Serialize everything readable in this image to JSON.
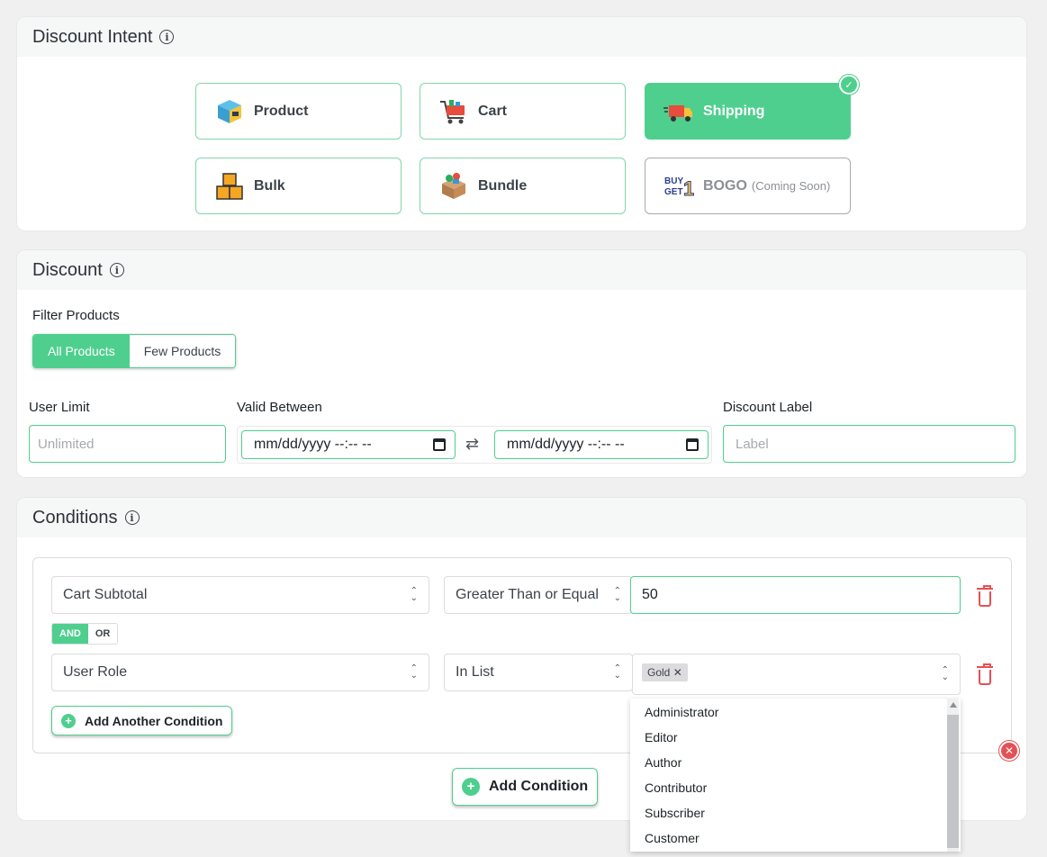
{
  "intent": {
    "title": "Discount Intent",
    "cards": [
      {
        "label": "Product",
        "icon": "product-box-icon"
      },
      {
        "label": "Cart",
        "icon": "cart-icon"
      },
      {
        "label": "Shipping",
        "icon": "shipping-truck-icon",
        "selected": true
      },
      {
        "label": "Bulk",
        "icon": "bulk-boxes-icon"
      },
      {
        "label": "Bundle",
        "icon": "bundle-icon"
      },
      {
        "label": "BOGO",
        "icon": "bogo-icon",
        "note": "(Coming Soon)",
        "disabled": true
      }
    ],
    "bogo_icon_text": "BUY GET 1"
  },
  "discount": {
    "title": "Discount",
    "filter_label": "Filter Products",
    "filter_options": [
      "All Products",
      "Few Products"
    ],
    "filter_selected": "All Products",
    "user_limit_label": "User Limit",
    "user_limit_placeholder": "Unlimited",
    "valid_between_label": "Valid Between",
    "date_from": "mm/dd/yyyy --:-- --",
    "date_to": "mm/dd/yyyy --:-- --",
    "label_label": "Discount Label",
    "label_placeholder": "Label"
  },
  "conditions": {
    "title": "Conditions",
    "rows": [
      {
        "field": "Cart Subtotal",
        "operator": "Greater Than or Equal",
        "value": "50"
      },
      {
        "field": "User Role",
        "operator": "In List",
        "tags": [
          "Gold"
        ]
      }
    ],
    "logic_options": [
      "AND",
      "OR"
    ],
    "logic_selected": "AND",
    "add_another_label": "Add Another Condition",
    "add_condition_label": "Add Condition",
    "dropdown_options": [
      "Administrator",
      "Editor",
      "Author",
      "Contributor",
      "Subscriber",
      "Customer"
    ]
  },
  "colors": {
    "accent": "#4fcf8e",
    "danger": "#e65054"
  }
}
